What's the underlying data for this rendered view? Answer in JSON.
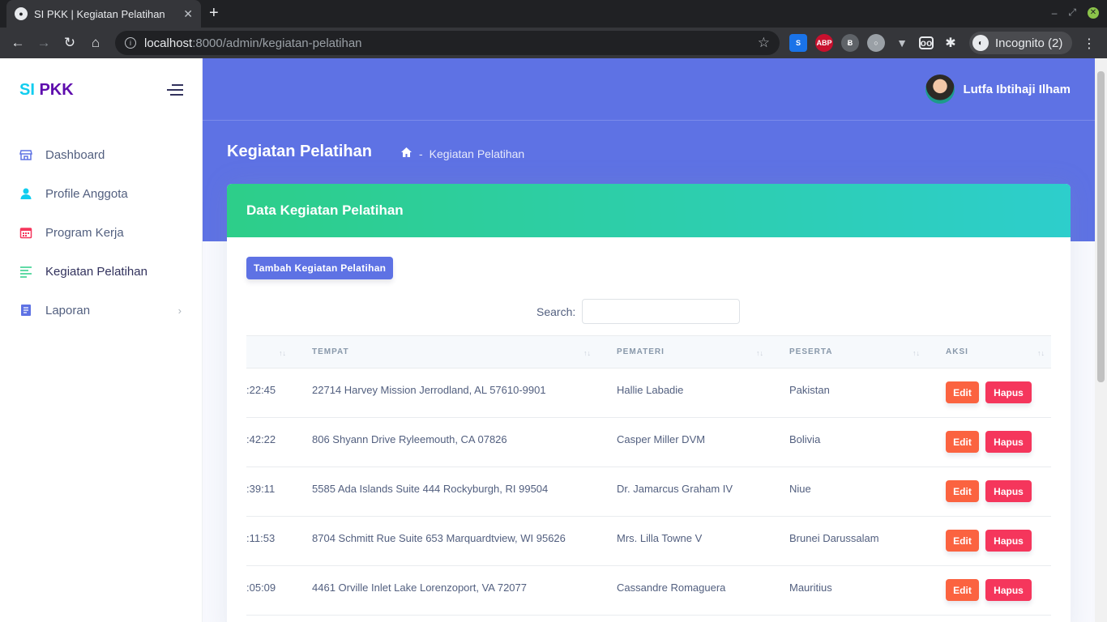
{
  "browser": {
    "tab_title": "SI PKK | Kegiatan Pelatihan",
    "url_host": "localhost",
    "url_path": ":8000/admin/kegiatan-pelatihan",
    "incognito_label": "Incognito (2)"
  },
  "sidebar": {
    "brand_si": "SI",
    "brand_pkk": "PKK",
    "items": [
      {
        "label": "Dashboard",
        "icon": "store-icon"
      },
      {
        "label": "Profile Anggota",
        "icon": "user-icon"
      },
      {
        "label": "Program Kerja",
        "icon": "calendar-icon"
      },
      {
        "label": "Kegiatan Pelatihan",
        "icon": "align-left-icon"
      },
      {
        "label": "Laporan",
        "icon": "document-icon"
      }
    ]
  },
  "header": {
    "user_name": "Lutfa Ibtihaji Ilham",
    "page_title": "Kegiatan Pelatihan",
    "breadcrumb_separator": "-",
    "breadcrumb_current": "Kegiatan Pelatihan"
  },
  "card": {
    "title": "Data Kegiatan Pelatihan",
    "add_button": "Tambah Kegiatan Pelatihan",
    "search_label": "Search:",
    "search_value": "",
    "columns": [
      "TEMPAT",
      "PEMATERI",
      "PESERTA",
      "AKSI"
    ],
    "rows": [
      {
        "time": ":22:45",
        "tempat": "22714 Harvey Mission Jerrodland, AL 57610-9901",
        "pemateri": "Hallie Labadie",
        "peserta": "Pakistan"
      },
      {
        "time": ":42:22",
        "tempat": "806 Shyann Drive Ryleemouth, CA 07826",
        "pemateri": "Casper Miller DVM",
        "peserta": "Bolivia"
      },
      {
        "time": ":39:11",
        "tempat": "5585 Ada Islands Suite 444 Rockyburgh, RI 99504",
        "pemateri": "Dr. Jamarcus Graham IV",
        "peserta": "Niue"
      },
      {
        "time": ":11:53",
        "tempat": "8704 Schmitt Rue Suite 653 Marquardtview, WI 95626",
        "pemateri": "Mrs. Lilla Towne V",
        "peserta": "Brunei Darussalam"
      },
      {
        "time": ":05:09",
        "tempat": "4461 Orville Inlet Lake Lorenzoport, VA 72077",
        "pemateri": "Cassandre Romaguera",
        "peserta": "Mauritius"
      }
    ],
    "edit_label": "Edit",
    "delete_label": "Hapus"
  },
  "colors": {
    "primary": "#5e72e4",
    "success_gradient_start": "#2dce89",
    "success_gradient_end": "#2dcecc",
    "warning": "#fb6340",
    "danger": "#f5365c"
  }
}
